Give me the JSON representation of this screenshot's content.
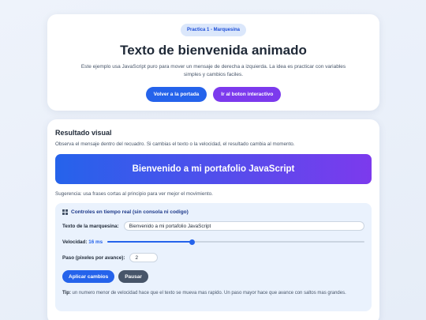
{
  "hero": {
    "badge": "Practica 1 - Marquesina",
    "title": "Texto de bienvenida animado",
    "description": "Este ejemplo usa JavaScript puro para mover un mensaje de derecha a izquierda. La idea es practicar con variables simples y cambios faciles.",
    "btn_home": "Volver a la portada",
    "btn_interactive": "Ir al boton interactivo"
  },
  "result": {
    "title": "Resultado visual",
    "description": "Observa el mensaje dentro del recuadro. Si cambias el texto o la velocidad, el resultado cambia al momento.",
    "marquee_text": "Bienvenido a mi portafolio JavaScript",
    "hint": "Sugerencia: usa frases cortas al principio para ver mejor el movimiento."
  },
  "controls": {
    "icon": "grid-icon",
    "title": "Controles en tiempo real (sin consola ni codigo)",
    "text_label": "Texto de la marquesina:",
    "text_value": "Bienvenido a mi portafolio JavaScript",
    "speed_label": "Velocidad:",
    "speed_value": "16 ms",
    "speed_fraction": 0.33,
    "step_label": "Paso (pixeles por avance):",
    "step_value": "2",
    "apply_button": "Aplicar cambios",
    "pause_button": "Pausar",
    "tip_label": "Tip:",
    "tip_text": " un numero menor de velocidad hace que el texto se mueva mas rapido. Un paso mayor hace que avance con saltos mas grandes."
  },
  "colors": {
    "accent": "#2563eb",
    "purple": "#7c3aed",
    "dark_button": "#475569"
  }
}
